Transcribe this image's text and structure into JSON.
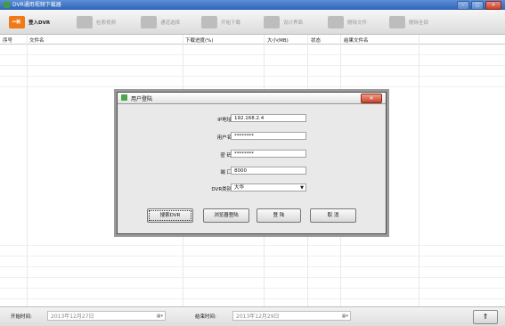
{
  "window": {
    "title": "DVR通用视频下载器",
    "minimize": "–",
    "maximize": "□",
    "close": "✕"
  },
  "toolbar": {
    "items": [
      {
        "label": "登入DVR",
        "icon": "login-icon",
        "active": true
      },
      {
        "label": "检索视频",
        "icon": "search-video-icon",
        "active": false
      },
      {
        "label": "通道选择",
        "icon": "channel-select-icon",
        "active": false
      },
      {
        "label": "开始下载",
        "icon": "start-download-icon",
        "active": false
      },
      {
        "label": "设计界面",
        "icon": "settings-icon",
        "active": false
      },
      {
        "label": "删除文件",
        "icon": "delete-file-icon",
        "active": false
      },
      {
        "label": "删除全部",
        "icon": "delete-all-icon",
        "active": false
      }
    ]
  },
  "table": {
    "columns": [
      "序号",
      "文件名",
      "下载进度(%)",
      "大小(MB)",
      "状态",
      "结果文件名"
    ],
    "rows": []
  },
  "login_dialog": {
    "title": "用户登陆",
    "close_label": "✕",
    "fields": {
      "ip": {
        "label": "IP地址:",
        "value": "192.168.2.4"
      },
      "username": {
        "label": "用户名:",
        "value": "********"
      },
      "password": {
        "label": "密  码:",
        "value": "********"
      },
      "port": {
        "label": "端  口:",
        "value": "8000"
      },
      "dvr_type": {
        "label": "DVR类别:",
        "value": "大华"
      }
    },
    "buttons": {
      "search_dvr": "搜索DVR",
      "browser_login": "浏览器登陆",
      "login": "登  陆",
      "cancel": "取  消"
    }
  },
  "statusbar": {
    "start_label": "开始时间:",
    "start_date": "2013年12月27日",
    "end_label": "结束时间:",
    "end_date": "2013年12月29日",
    "up_button": "⇑"
  }
}
